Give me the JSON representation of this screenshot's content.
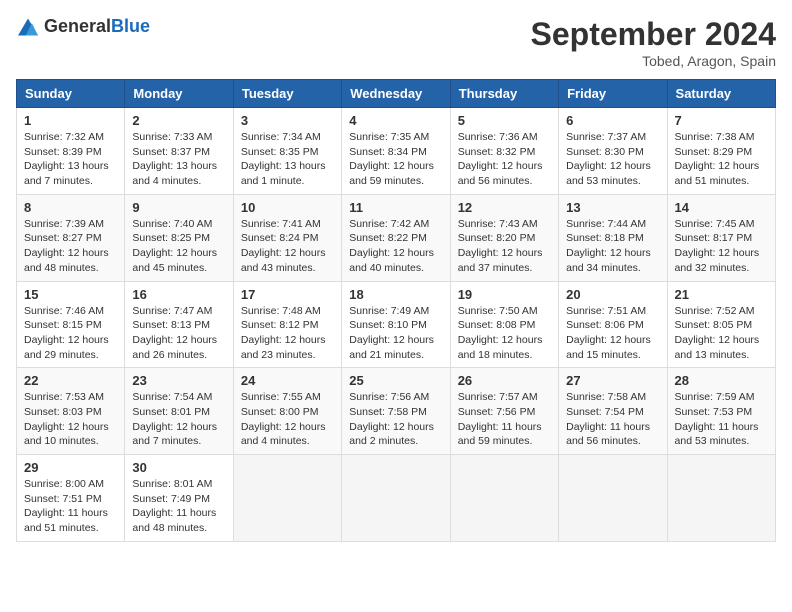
{
  "logo": {
    "general": "General",
    "blue": "Blue"
  },
  "header": {
    "month": "September 2024",
    "location": "Tobed, Aragon, Spain"
  },
  "weekdays": [
    "Sunday",
    "Monday",
    "Tuesday",
    "Wednesday",
    "Thursday",
    "Friday",
    "Saturday"
  ],
  "weeks": [
    [
      {
        "day": "1",
        "sunrise": "7:32 AM",
        "sunset": "8:39 PM",
        "daylight": "13 hours and 7 minutes."
      },
      {
        "day": "2",
        "sunrise": "7:33 AM",
        "sunset": "8:37 PM",
        "daylight": "13 hours and 4 minutes."
      },
      {
        "day": "3",
        "sunrise": "7:34 AM",
        "sunset": "8:35 PM",
        "daylight": "13 hours and 1 minute."
      },
      {
        "day": "4",
        "sunrise": "7:35 AM",
        "sunset": "8:34 PM",
        "daylight": "12 hours and 59 minutes."
      },
      {
        "day": "5",
        "sunrise": "7:36 AM",
        "sunset": "8:32 PM",
        "daylight": "12 hours and 56 minutes."
      },
      {
        "day": "6",
        "sunrise": "7:37 AM",
        "sunset": "8:30 PM",
        "daylight": "12 hours and 53 minutes."
      },
      {
        "day": "7",
        "sunrise": "7:38 AM",
        "sunset": "8:29 PM",
        "daylight": "12 hours and 51 minutes."
      }
    ],
    [
      {
        "day": "8",
        "sunrise": "7:39 AM",
        "sunset": "8:27 PM",
        "daylight": "12 hours and 48 minutes."
      },
      {
        "day": "9",
        "sunrise": "7:40 AM",
        "sunset": "8:25 PM",
        "daylight": "12 hours and 45 minutes."
      },
      {
        "day": "10",
        "sunrise": "7:41 AM",
        "sunset": "8:24 PM",
        "daylight": "12 hours and 43 minutes."
      },
      {
        "day": "11",
        "sunrise": "7:42 AM",
        "sunset": "8:22 PM",
        "daylight": "12 hours and 40 minutes."
      },
      {
        "day": "12",
        "sunrise": "7:43 AM",
        "sunset": "8:20 PM",
        "daylight": "12 hours and 37 minutes."
      },
      {
        "day": "13",
        "sunrise": "7:44 AM",
        "sunset": "8:18 PM",
        "daylight": "12 hours and 34 minutes."
      },
      {
        "day": "14",
        "sunrise": "7:45 AM",
        "sunset": "8:17 PM",
        "daylight": "12 hours and 32 minutes."
      }
    ],
    [
      {
        "day": "15",
        "sunrise": "7:46 AM",
        "sunset": "8:15 PM",
        "daylight": "12 hours and 29 minutes."
      },
      {
        "day": "16",
        "sunrise": "7:47 AM",
        "sunset": "8:13 PM",
        "daylight": "12 hours and 26 minutes."
      },
      {
        "day": "17",
        "sunrise": "7:48 AM",
        "sunset": "8:12 PM",
        "daylight": "12 hours and 23 minutes."
      },
      {
        "day": "18",
        "sunrise": "7:49 AM",
        "sunset": "8:10 PM",
        "daylight": "12 hours and 21 minutes."
      },
      {
        "day": "19",
        "sunrise": "7:50 AM",
        "sunset": "8:08 PM",
        "daylight": "12 hours and 18 minutes."
      },
      {
        "day": "20",
        "sunrise": "7:51 AM",
        "sunset": "8:06 PM",
        "daylight": "12 hours and 15 minutes."
      },
      {
        "day": "21",
        "sunrise": "7:52 AM",
        "sunset": "8:05 PM",
        "daylight": "12 hours and 13 minutes."
      }
    ],
    [
      {
        "day": "22",
        "sunrise": "7:53 AM",
        "sunset": "8:03 PM",
        "daylight": "12 hours and 10 minutes."
      },
      {
        "day": "23",
        "sunrise": "7:54 AM",
        "sunset": "8:01 PM",
        "daylight": "12 hours and 7 minutes."
      },
      {
        "day": "24",
        "sunrise": "7:55 AM",
        "sunset": "8:00 PM",
        "daylight": "12 hours and 4 minutes."
      },
      {
        "day": "25",
        "sunrise": "7:56 AM",
        "sunset": "7:58 PM",
        "daylight": "12 hours and 2 minutes."
      },
      {
        "day": "26",
        "sunrise": "7:57 AM",
        "sunset": "7:56 PM",
        "daylight": "11 hours and 59 minutes."
      },
      {
        "day": "27",
        "sunrise": "7:58 AM",
        "sunset": "7:54 PM",
        "daylight": "11 hours and 56 minutes."
      },
      {
        "day": "28",
        "sunrise": "7:59 AM",
        "sunset": "7:53 PM",
        "daylight": "11 hours and 53 minutes."
      }
    ],
    [
      {
        "day": "29",
        "sunrise": "8:00 AM",
        "sunset": "7:51 PM",
        "daylight": "11 hours and 51 minutes."
      },
      {
        "day": "30",
        "sunrise": "8:01 AM",
        "sunset": "7:49 PM",
        "daylight": "11 hours and 48 minutes."
      },
      null,
      null,
      null,
      null,
      null
    ]
  ]
}
